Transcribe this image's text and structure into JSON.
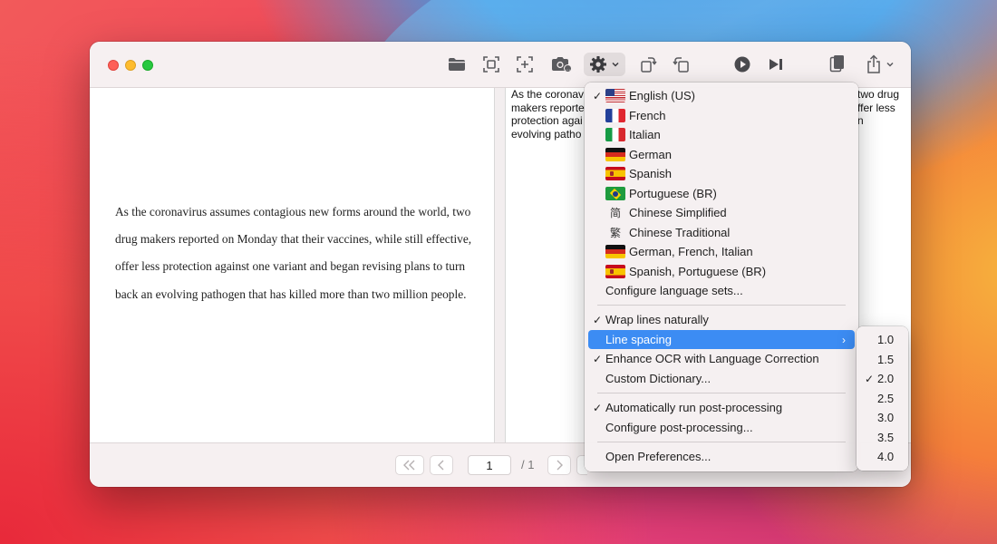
{
  "document": {
    "text": "As the coronavirus assumes contagious new forms around the world, two drug makers reported on Monday that their vaccines, while still effective, offer less protection against one variant and began revising plans to turn back an evolving pathogen that has killed more than two million people.",
    "ocr_left_lines": [
      "As the coronav",
      "makers reporte",
      "protection agai",
      "evolving patho"
    ],
    "ocr_right_lines": [
      "two drug",
      "ffer less",
      "n",
      ""
    ]
  },
  "toolbar": {
    "icons": [
      "folder-icon",
      "capture-area-icon",
      "capture-add-icon",
      "camera-icon",
      "gear-icon",
      "rotate-right-icon",
      "rotate-left-icon",
      "play-icon",
      "skip-forward-icon",
      "clipboard-icon",
      "share-icon"
    ]
  },
  "pagination": {
    "current_page": "1",
    "total": "/ 1"
  },
  "menu": {
    "languages": [
      {
        "label": "English (US)",
        "checked": true,
        "flag": "us"
      },
      {
        "label": "French",
        "checked": false,
        "flag": "fr"
      },
      {
        "label": "Italian",
        "checked": false,
        "flag": "it"
      },
      {
        "label": "German",
        "checked": false,
        "flag": "de"
      },
      {
        "label": "Spanish",
        "checked": false,
        "flag": "es"
      },
      {
        "label": "Portuguese (BR)",
        "checked": false,
        "flag": "br"
      },
      {
        "label": "Chinese Simplified",
        "checked": false,
        "flag": "简"
      },
      {
        "label": "Chinese Traditional",
        "checked": false,
        "flag": "繁"
      },
      {
        "label": "German, French, Italian",
        "checked": false,
        "flag": "de"
      },
      {
        "label": "Spanish, Portuguese (BR)",
        "checked": false,
        "flag": "es"
      }
    ],
    "configure_language_sets": "Configure language sets...",
    "wrap_lines": "Wrap lines naturally",
    "line_spacing": "Line spacing",
    "enhance_ocr": "Enhance OCR with Language Correction",
    "custom_dictionary": "Custom Dictionary...",
    "auto_post_processing": "Automatically run post-processing",
    "configure_post_processing": "Configure post-processing...",
    "open_preferences": "Open Preferences...",
    "checkmark": "✓",
    "submenu_arrow": "›"
  },
  "line_spacing_submenu": {
    "options": [
      "1.0",
      "1.5",
      "2.0",
      "2.5",
      "3.0",
      "3.5",
      "4.0"
    ],
    "selected": "2.0"
  },
  "colors": {
    "highlight": "#3c8cf3",
    "close": "#fe5f57",
    "minimize": "#febc2e",
    "maximize": "#28c840"
  }
}
